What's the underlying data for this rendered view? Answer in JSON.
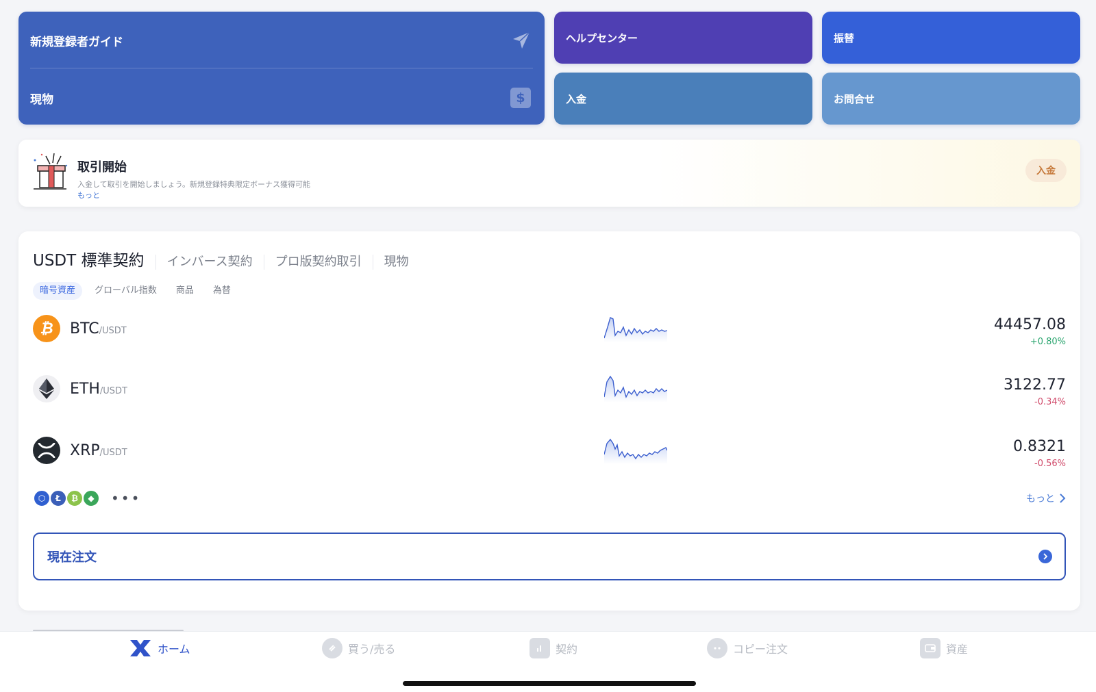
{
  "tiles": {
    "guide": "新規登録者ガイド",
    "spot": "現物",
    "help_center": "ヘルプセンター",
    "transfer": "振替",
    "deposit": "入金",
    "contact": "お問合せ"
  },
  "promo": {
    "title": "取引開始",
    "description": "入金して取引を開始しましょう。新規登録特典限定ボーナス獲得可能",
    "more": "もっと",
    "button": "入金"
  },
  "market": {
    "tabs": [
      "USDT 標準契約",
      "インバース契約",
      "プロ版契約取引",
      "現物"
    ],
    "sub_tabs": [
      "暗号資産",
      "グローバル指数",
      "商品",
      "為替"
    ],
    "coins": [
      {
        "symbol": "BTC",
        "pair": "/USDT",
        "price": "44457.08",
        "change": "+0.80%",
        "direction": "up",
        "icon": "bitcoin-icon",
        "color": "#f7931a"
      },
      {
        "symbol": "ETH",
        "pair": "/USDT",
        "price": "3122.77",
        "change": "-0.34%",
        "direction": "down",
        "icon": "ethereum-icon",
        "color": "#efeff2"
      },
      {
        "symbol": "XRP",
        "pair": "/USDT",
        "price": "0.8321",
        "change": "-0.56%",
        "direction": "down",
        "icon": "xrp-icon",
        "color": "#23292f"
      }
    ],
    "more_link": "もっと",
    "dots": "•••",
    "current_orders": "現在注文"
  },
  "nav": {
    "home": "ホーム",
    "buy_sell": "買う/売る",
    "contract": "契約",
    "copy_order": "コピー注文",
    "assets": "資産"
  },
  "colors": {
    "accent": "#3053c9",
    "up": "#2ba56f",
    "down": "#d04a6a"
  }
}
